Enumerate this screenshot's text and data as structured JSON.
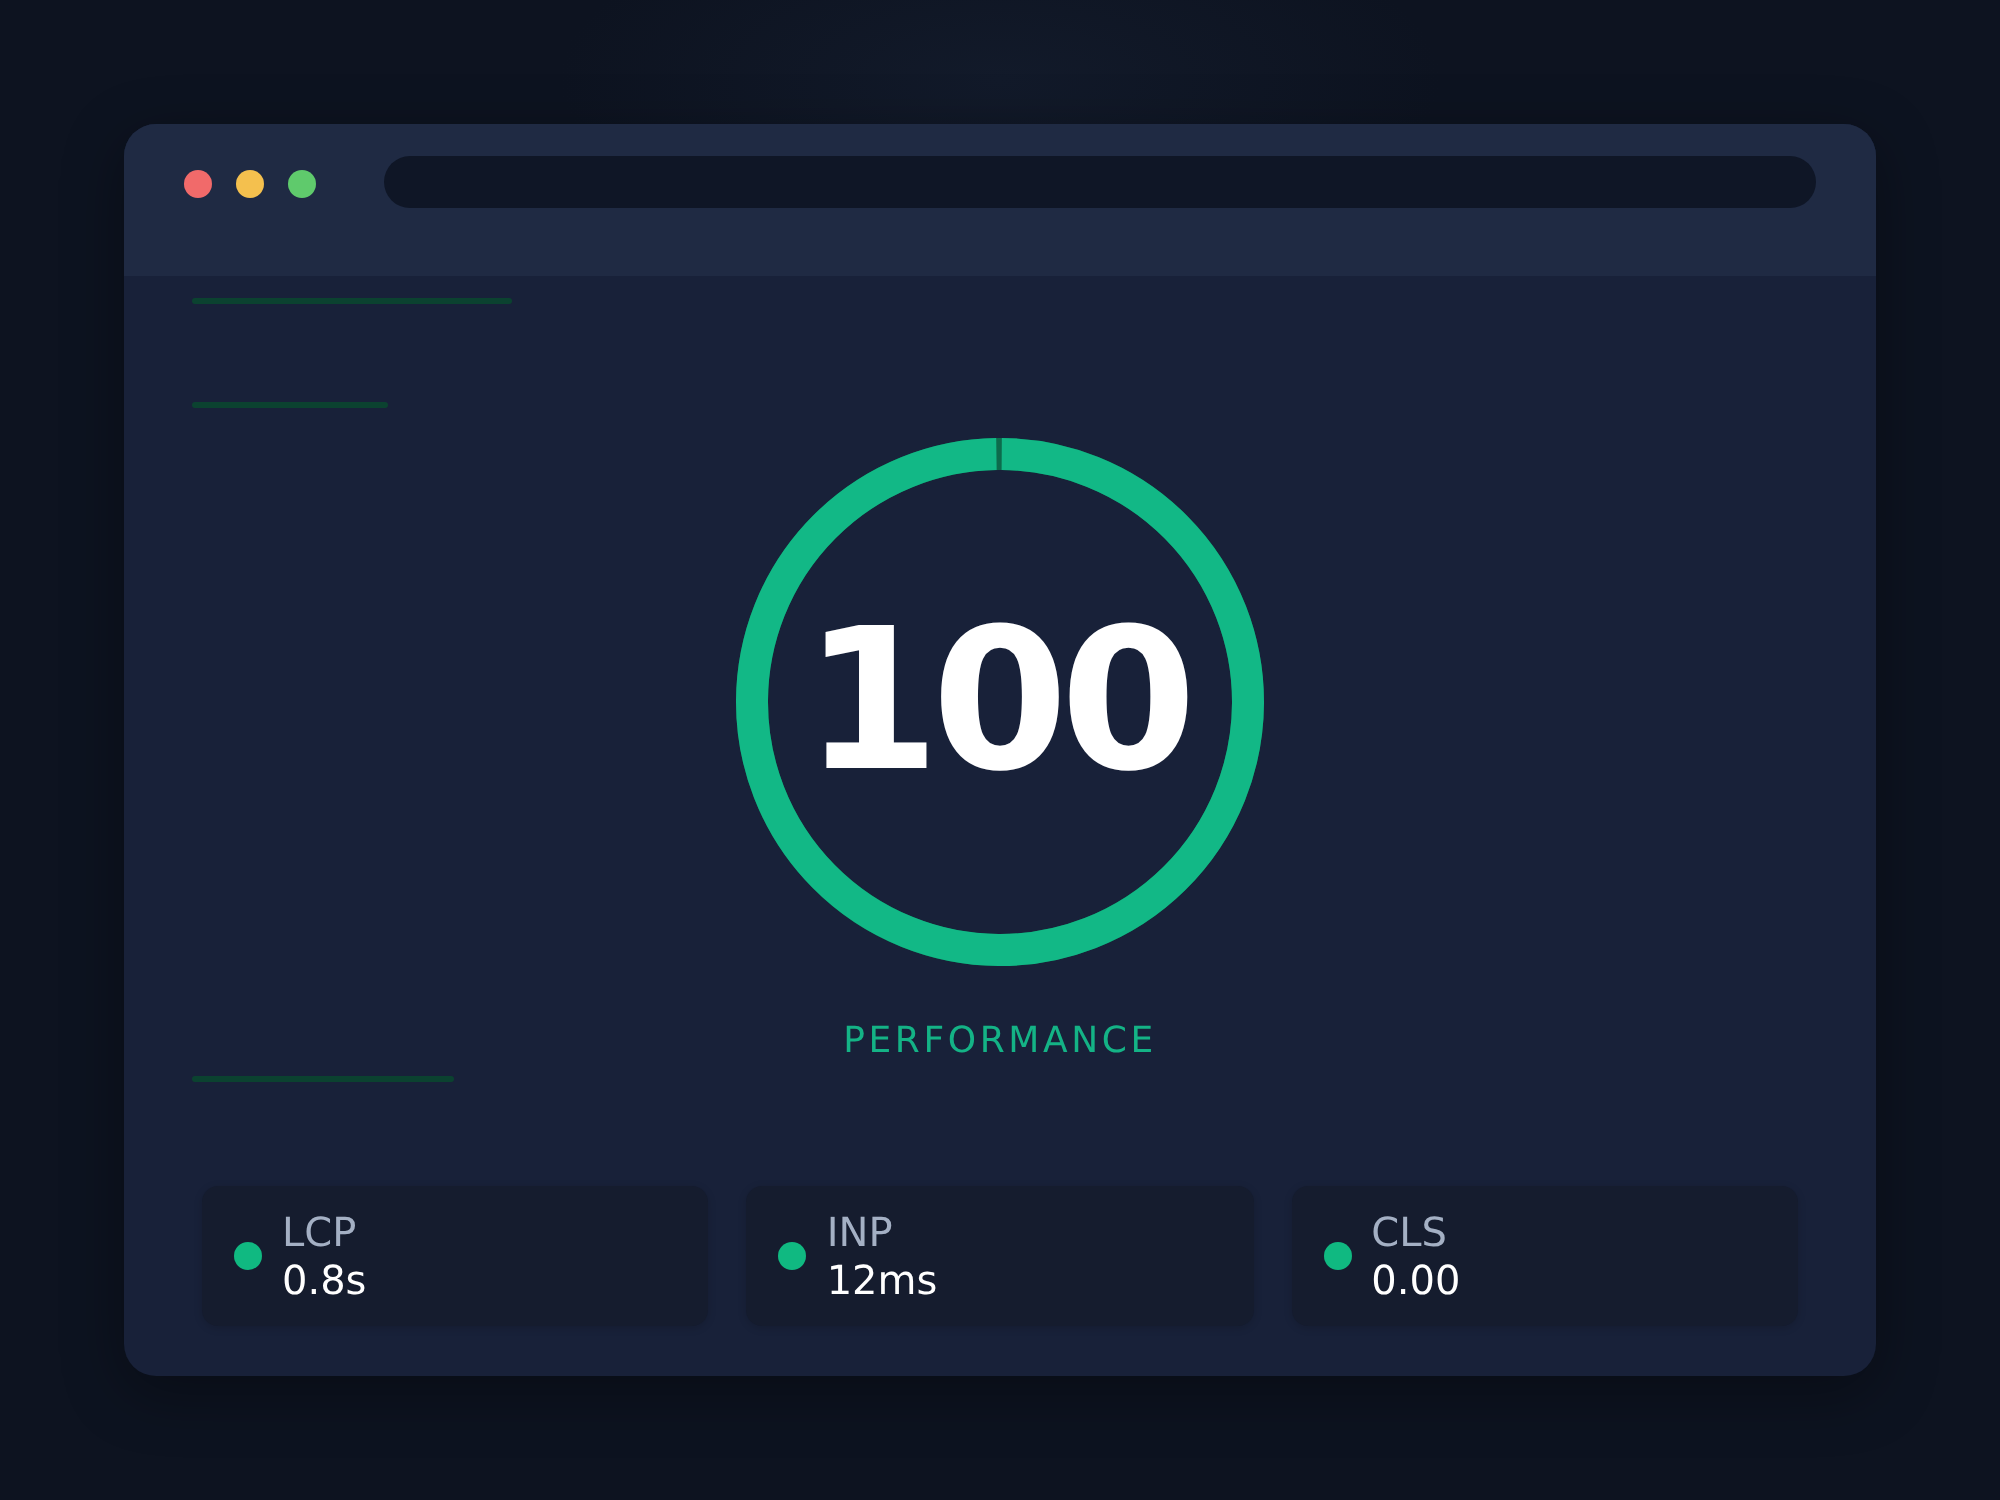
{
  "score": {
    "value": "100",
    "level": 1,
    "label": "PERFORMANCE"
  },
  "metrics": [
    {
      "name": "LCP",
      "value": "0.8s",
      "color": "#10b981"
    },
    {
      "name": "INP",
      "value": "12ms",
      "color": "#10b981"
    },
    {
      "name": "CLS",
      "value": "0.00",
      "color": "#10b981"
    }
  ]
}
